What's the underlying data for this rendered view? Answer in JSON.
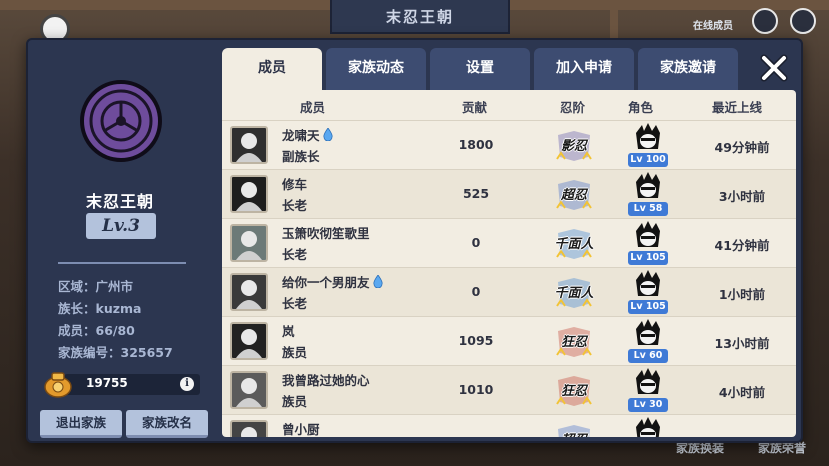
{
  "background": {
    "top_title": "末忍王朝",
    "online_label": "在线成员",
    "bottom_labels": [
      "家族换装",
      "家族荣誉"
    ]
  },
  "clan": {
    "name": "末忍王朝",
    "level": "Lv.3",
    "region": "区域：广州市",
    "leader": "族长：kuzma",
    "members": "成员：66/80",
    "clan_id": "家族编号：325657",
    "funds": "19755",
    "info_symbol": "i",
    "leave_button": "退出家族",
    "rename_button": "家族改名"
  },
  "tabs": [
    {
      "label": "成员",
      "active": true
    },
    {
      "label": "家族动态",
      "active": false
    },
    {
      "label": "设置",
      "active": false
    },
    {
      "label": "加入申请",
      "active": false
    },
    {
      "label": "家族邀请",
      "active": false
    }
  ],
  "table": {
    "headers": {
      "member": "成员",
      "contribution": "贡献",
      "rank": "忍阶",
      "character": "角色",
      "last_online": "最近上线"
    },
    "rows": [
      {
        "name": "龙啸天",
        "droplet": true,
        "role": "副族长",
        "contribution": "1800",
        "rank": "影忍",
        "rank_color": "#5a4fa8",
        "level": "Lv 100",
        "last_online": "49分钟前"
      },
      {
        "name": "修车",
        "droplet": false,
        "role": "长老",
        "contribution": "525",
        "rank": "超忍",
        "rank_color": "#3c66c8",
        "level": "Lv 58",
        "last_online": "3小时前"
      },
      {
        "name": "玉箫吹彻笙歌里",
        "droplet": false,
        "role": "长老",
        "contribution": "0",
        "rank": "千面人",
        "rank_color": "#2f7ad1",
        "level": "Lv 105",
        "last_online": "41分钟前"
      },
      {
        "name": "给你一个男朋友",
        "droplet": true,
        "role": "长老",
        "contribution": "0",
        "rank": "千面人",
        "rank_color": "#2f7ad1",
        "level": "Lv 105",
        "last_online": "1小时前"
      },
      {
        "name": "岚",
        "droplet": false,
        "role": "族员",
        "contribution": "1095",
        "rank": "狂忍",
        "rank_color": "#c0392b",
        "level": "Lv 60",
        "last_online": "13小时前"
      },
      {
        "name": "我曾路过她的心",
        "droplet": false,
        "role": "族员",
        "contribution": "1010",
        "rank": "狂忍",
        "rank_color": "#c0392b",
        "level": "Lv 30",
        "last_online": "4小时前"
      },
      {
        "name": "曾小厨",
        "droplet": false,
        "role": "",
        "contribution": "",
        "rank": "超忍",
        "rank_color": "#3c66c8",
        "level": "",
        "last_online": ""
      }
    ]
  }
}
